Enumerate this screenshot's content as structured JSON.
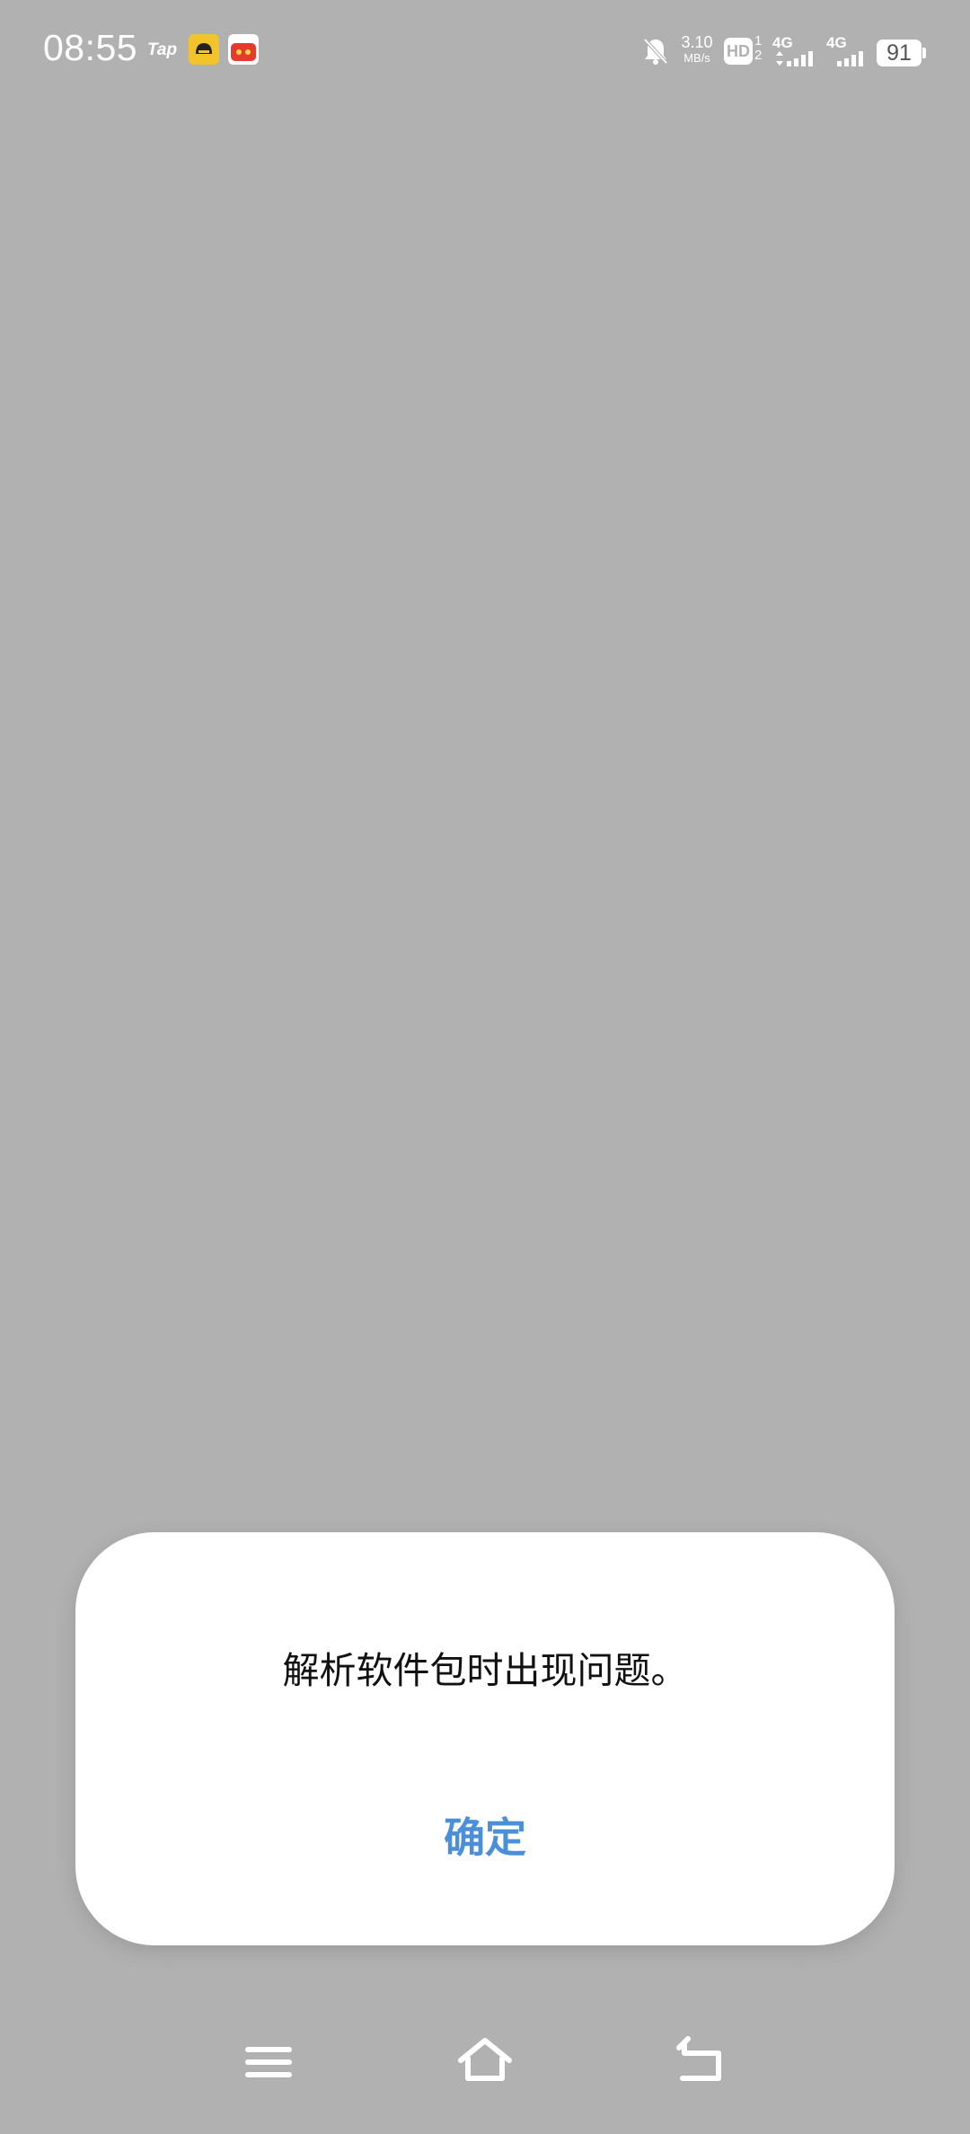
{
  "status_bar": {
    "time": "08:55",
    "tap_label": "Tap",
    "speed_value": "3.10",
    "speed_unit": "MB/s",
    "hd_label": "HD",
    "hd_sim_top": "1",
    "hd_sim_bottom": "2",
    "network_1": "4G",
    "network_2": "4G",
    "battery": "91",
    "icons": [
      "mute-bell-icon",
      "signal-icon",
      "battery-icon"
    ]
  },
  "dialog": {
    "message": "解析软件包时出现问题。",
    "confirm_label": "确定",
    "accent_color": "#4a8fd8"
  },
  "nav_bar": {
    "icons": [
      "menu-icon",
      "home-icon",
      "back-icon"
    ]
  },
  "colors": {
    "background": "#b1b1b1",
    "dialog_background": "#ffffff"
  }
}
